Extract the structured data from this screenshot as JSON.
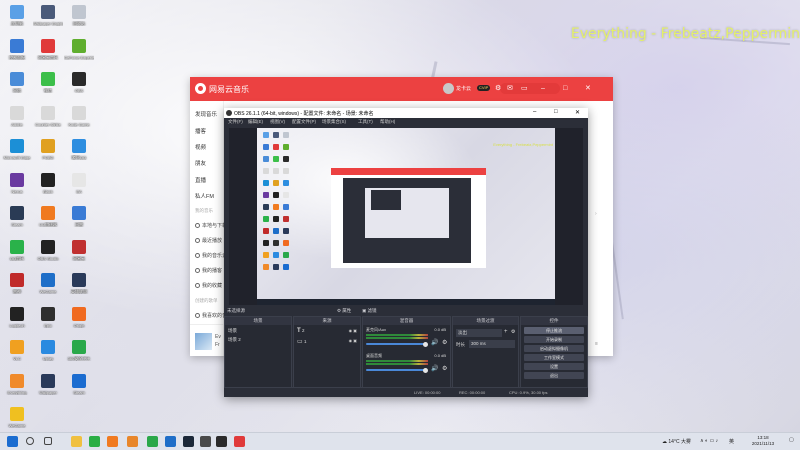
{
  "overlay_text": "Everything - Frebeatz,Peppermin",
  "desktop": {
    "icons": [
      {
        "label": "此电脑",
        "color": "#5aa0e6"
      },
      {
        "label": "Wallpaper Engine",
        "color": "#4a5a7a"
      },
      {
        "label": "回收站",
        "color": "#c0c6d0"
      },
      {
        "label": "控制面板",
        "color": "#3a7bd5"
      },
      {
        "label": "网易云音乐",
        "color": "#e03a3a"
      },
      {
        "label": "GeForce Experience",
        "color": "#5fae2e"
      },
      {
        "label": "网络",
        "color": "#4a8cd8"
      },
      {
        "label": "微信",
        "color": "#3cbf4a"
      },
      {
        "label": "OBS",
        "color": "#2a2a2a"
      },
      {
        "label": "Adobe",
        "color": "#d9d9d9"
      },
      {
        "label": "Counter-Strike",
        "color": "#d9d9d9"
      },
      {
        "label": "Kode Game",
        "color": "#d9d9d9"
      },
      {
        "label": "Microsoft Edge",
        "color": "#1c8fd6"
      },
      {
        "label": "PUBG",
        "color": "#e0a020"
      },
      {
        "label": "腾讯QQ",
        "color": "#2e8ee0"
      },
      {
        "label": "Nexus",
        "color": "#6a3aa0"
      },
      {
        "label": "Black",
        "color": "#222"
      },
      {
        "label": "EA",
        "color": "#e6e6e6"
      },
      {
        "label": "Steam",
        "color": "#2a3b55"
      },
      {
        "label": "UU加速器",
        "color": "#f07a20"
      },
      {
        "label": "迅雷",
        "color": "#3a7bd5"
      },
      {
        "label": "QQ音乐",
        "color": "#2ab24a"
      },
      {
        "label": "OBS Studio",
        "color": "#222"
      },
      {
        "label": "网易云",
        "color": "#c03030"
      },
      {
        "label": "雷神",
        "color": "#c02a2a"
      },
      {
        "label": "WeGame",
        "color": "#1e6ec8"
      },
      {
        "label": "英雄联盟",
        "color": "#2a3a5a"
      },
      {
        "label": "Logitech",
        "color": "#222"
      },
      {
        "label": "Epic",
        "color": "#2f2f2f"
      },
      {
        "label": "Origin",
        "color": "#f06a20"
      },
      {
        "label": "VLC",
        "color": "#f0a020"
      },
      {
        "label": "Uplay",
        "color": "#2a8ae0"
      },
      {
        "label": "360安全卫士",
        "color": "#2aa84a"
      },
      {
        "label": "Everything",
        "color": "#f08a2a"
      },
      {
        "label": "Wallpaper",
        "color": "#2a3a5a"
      },
      {
        "label": "Steam",
        "color": "#1b6cd0"
      },
      {
        "label": "WeGame",
        "color": "#f0c020"
      }
    ]
  },
  "music": {
    "app_name": "网易云音乐",
    "user": "龙卡云",
    "vip": "CVIP",
    "sidebar": {
      "items": [
        "发现音乐",
        "播客",
        "视频",
        "朋友",
        "直播",
        "私人FM"
      ],
      "section_mine": "我的音乐",
      "rows": [
        "本地与下载",
        "最近播放",
        "我的音乐云盘",
        "我的播客",
        "我的收藏"
      ],
      "section_created": "创建的歌单",
      "liked": "我喜欢的音乐"
    },
    "now_playing": {
      "title": "Ev",
      "artist": "Fr"
    }
  },
  "obs": {
    "title": "OBS 26.1.1 (64-bit, windows) - 配置文件: 未命名 - 场景: 未命名",
    "menu": [
      "文件(F)",
      "编辑(E)",
      "视图(V)",
      "配置文件(P)",
      "场景集合(S)",
      "工具(T)",
      "帮助(H)"
    ],
    "preview_overlay": "Everything - Frebeatz,Peppermint",
    "controls": [
      "属性",
      "滤镜"
    ],
    "no_source": "未选择源",
    "docks": {
      "scenes": {
        "title": "场景",
        "items": [
          "场景",
          "场景 2"
        ]
      },
      "sources": {
        "title": "来源",
        "items": [
          "2",
          "1"
        ]
      },
      "mixer": {
        "title": "混音器",
        "channels": [
          {
            "name": "麦克风/Aux",
            "db": "0.0 dB",
            "level": 0.6
          },
          {
            "name": "桌面音频",
            "db": "0.0 dB",
            "level": 0.5
          }
        ]
      },
      "transitions": {
        "title": "场景过渡",
        "type": "淡出",
        "duration_label": "时长",
        "duration": "300 ms"
      },
      "controls": {
        "title": "控件",
        "buttons": [
          "停止推流",
          "开始录制",
          "启动虚拟摄像机",
          "工作室模式",
          "设置",
          "退出"
        ]
      }
    },
    "status": {
      "live": "LIVE: 00:00:00",
      "rec": "REC: 00:00:00",
      "cpu": "CPU: 0.9%, 30.00 fps"
    }
  },
  "taskbar": {
    "icons": [
      {
        "name": "start",
        "color": "#1b6cd0"
      },
      {
        "name": "search",
        "color": "#444"
      },
      {
        "name": "task-view",
        "color": "#444"
      },
      {
        "name": "file-explorer",
        "color": "#f0c040"
      },
      {
        "name": "wechat",
        "color": "#2aae45"
      },
      {
        "name": "uu",
        "color": "#f07a20"
      },
      {
        "name": "app-orange",
        "color": "#e8862a"
      },
      {
        "name": "app-green",
        "color": "#2aa84a"
      },
      {
        "name": "app-blue",
        "color": "#1e6ec8"
      },
      {
        "name": "steam",
        "color": "#1b2838"
      },
      {
        "name": "app-dark",
        "color": "#4a4a4a"
      },
      {
        "name": "obs",
        "color": "#2b2b2b"
      },
      {
        "name": "netease",
        "color": "#e03a3a"
      }
    ],
    "weather": "14°C 大雾",
    "ime": "英",
    "time": "13:18",
    "date": "2021/11/13"
  }
}
